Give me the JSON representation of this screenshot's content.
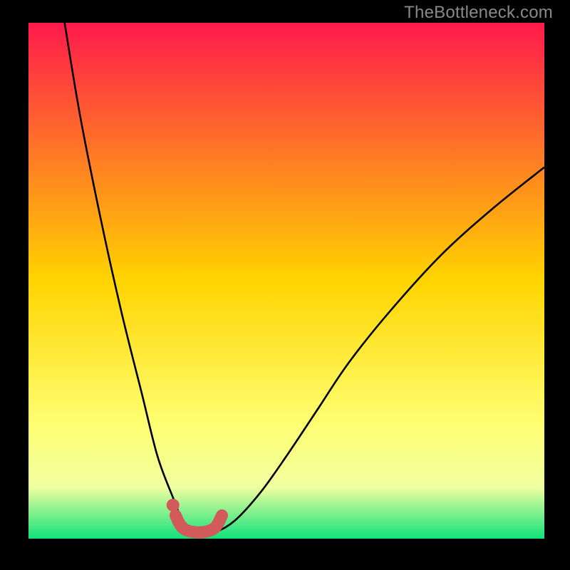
{
  "watermark": "TheBottleneck.com",
  "colors": {
    "frame": "#000000",
    "grad_top": "#ff1a4c",
    "grad_mid": "#ffd400",
    "grad_low": "#ffff73",
    "grad_soft": "#f0ffa0",
    "grad_bottom": "#11e27b",
    "curve": "#000000",
    "marker_fill": "#d35a5a",
    "marker_stroke": "#c34f4f"
  },
  "chart_data": {
    "type": "line",
    "title": "",
    "xlabel": "",
    "ylabel": "",
    "xlim": [
      0,
      100
    ],
    "ylim": [
      0,
      100
    ],
    "series": [
      {
        "name": "bottleneck-curve",
        "x": [
          7,
          10,
          14,
          18,
          22,
          25,
          28,
          30,
          33,
          36,
          40,
          45,
          50,
          56,
          62,
          70,
          80,
          90,
          100
        ],
        "y": [
          100,
          82,
          62,
          44,
          28,
          16,
          8,
          3.5,
          1.2,
          1.2,
          3.5,
          9,
          16,
          25,
          34,
          44,
          55,
          64,
          72
        ]
      }
    ],
    "highlight_segment": {
      "name": "optimal-range",
      "x": [
        28.5,
        30,
        33,
        36,
        37.5
      ],
      "y": [
        4.5,
        2.0,
        1.2,
        2.0,
        4.5
      ]
    },
    "highlight_dot": {
      "x": 28,
      "y": 6.5
    }
  }
}
